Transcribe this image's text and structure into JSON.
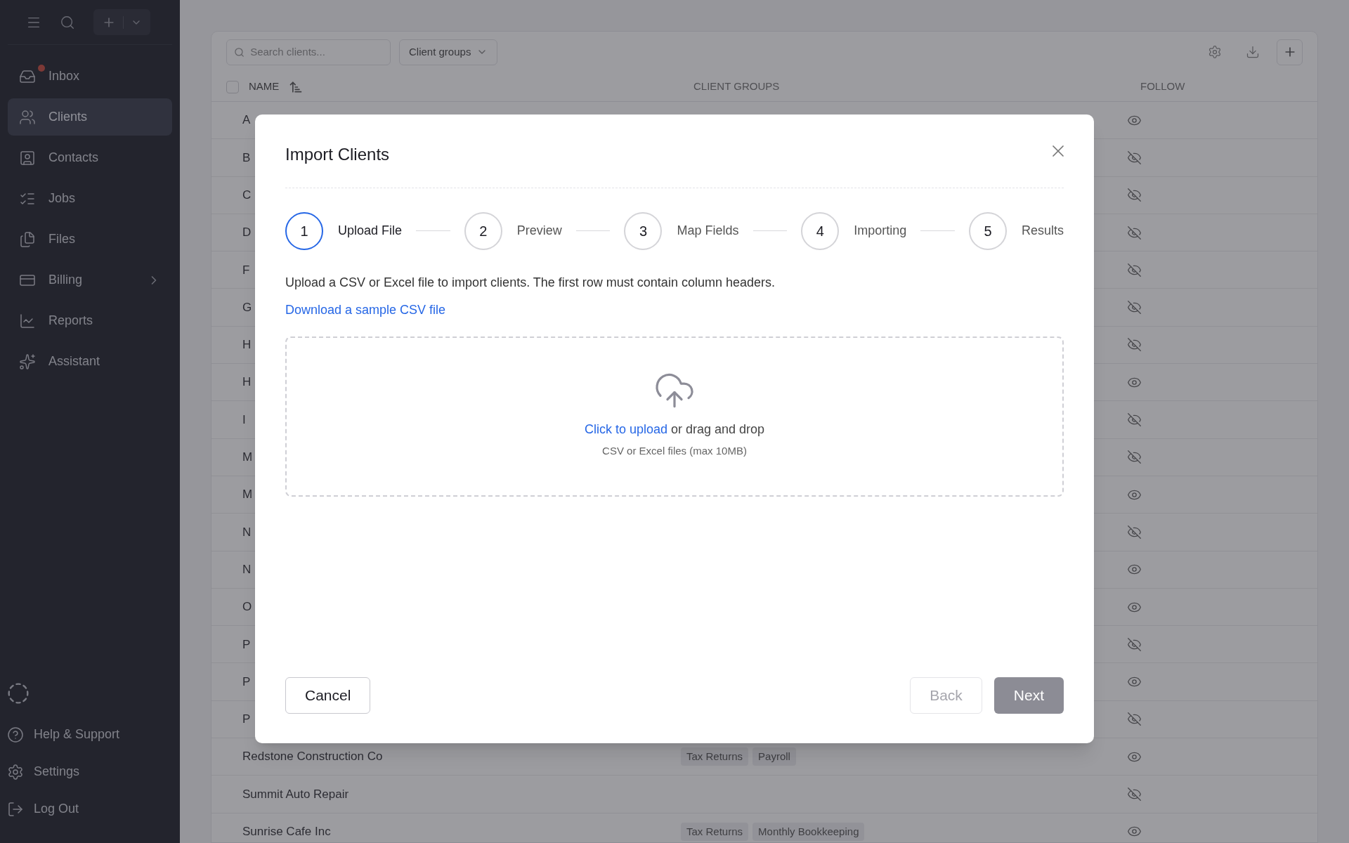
{
  "sidebar": {
    "nav_items": [
      {
        "label": "Inbox",
        "selected": false,
        "unread": true,
        "expandable": false
      },
      {
        "label": "Clients",
        "selected": true,
        "unread": false,
        "expandable": false
      },
      {
        "label": "Contacts",
        "selected": false,
        "unread": false,
        "expandable": false
      },
      {
        "label": "Jobs",
        "selected": false,
        "unread": false,
        "expandable": false
      },
      {
        "label": "Files",
        "selected": false,
        "unread": false,
        "expandable": false
      },
      {
        "label": "Billing",
        "selected": false,
        "unread": false,
        "expandable": true
      },
      {
        "label": "Reports",
        "selected": false,
        "unread": false,
        "expandable": false
      },
      {
        "label": "Assistant",
        "selected": false,
        "unread": false,
        "expandable": false
      }
    ],
    "footer_items": [
      "Help & Support",
      "Settings",
      "Log Out"
    ]
  },
  "toolbar": {
    "search": {
      "placeholder": "Search clients..."
    },
    "filter": "Client groups"
  },
  "table": {
    "select_all_checked": false,
    "columns": [
      "NAME",
      "CLIENT GROUPS",
      "FOLLOW"
    ],
    "rows": [
      {
        "name": "A",
        "groups": [],
        "following": true
      },
      {
        "name": "B",
        "groups": [],
        "following": false
      },
      {
        "name": "C",
        "groups": [],
        "following": false
      },
      {
        "name": "D",
        "groups": [],
        "following": false
      },
      {
        "name": "F",
        "groups": [],
        "following": false
      },
      {
        "name": "G",
        "groups": [],
        "following": false
      },
      {
        "name": "H",
        "groups": [],
        "following": false
      },
      {
        "name": "H",
        "groups": [],
        "following": true
      },
      {
        "name": "I",
        "groups": [],
        "following": false
      },
      {
        "name": "M",
        "groups": [],
        "following": false
      },
      {
        "name": "M",
        "groups": [],
        "following": true
      },
      {
        "name": "N",
        "groups": [],
        "following": false
      },
      {
        "name": "N",
        "groups": [],
        "following": true
      },
      {
        "name": "O",
        "groups": [],
        "following": true
      },
      {
        "name": "P",
        "groups": [],
        "following": false
      },
      {
        "name": "P",
        "groups": [],
        "following": true
      },
      {
        "name": "P",
        "groups": [],
        "following": false
      },
      {
        "name": "Redstone Construction Co",
        "groups": [
          "Tax Returns",
          "Payroll"
        ],
        "following": true
      },
      {
        "name": "Summit Auto Repair",
        "groups": [],
        "following": false
      },
      {
        "name": "Sunrise Cafe Inc",
        "groups": [
          "Tax Returns",
          "Monthly Bookkeeping"
        ],
        "following": true
      }
    ]
  },
  "dialog": {
    "title": "Import Clients",
    "steps": [
      {
        "number": "1",
        "label": "Upload File",
        "selected": true
      },
      {
        "number": "2",
        "label": "Preview",
        "selected": false
      },
      {
        "number": "3",
        "label": "Map Fields",
        "selected": false
      },
      {
        "number": "4",
        "label": "Importing",
        "selected": false
      },
      {
        "number": "5",
        "label": "Results",
        "selected": false
      }
    ],
    "instructions": "Upload a CSV or Excel file to import clients. The first row must contain column headers.",
    "sample_link": "Download a sample CSV file",
    "dropzone": {
      "link": "Click to upload",
      "text": "or drag and drop",
      "hint": "CSV or Excel files (max 10MB)"
    },
    "cancel": {
      "label": "Cancel",
      "disabled": false
    },
    "back": {
      "label": "Back",
      "disabled": true
    },
    "next": {
      "label": "Next",
      "disabled": true
    }
  }
}
